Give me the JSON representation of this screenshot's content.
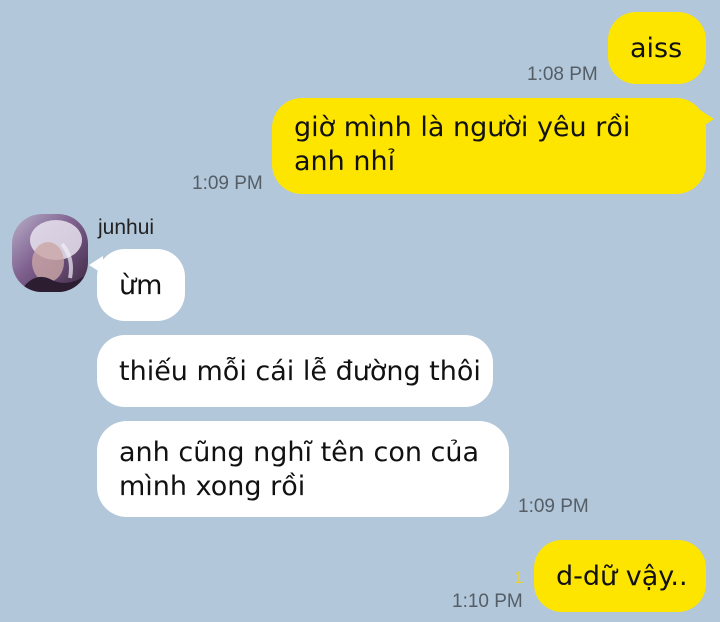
{
  "messages": [
    {
      "side": "out",
      "text": "aiss",
      "time": "1:08 PM"
    },
    {
      "side": "out",
      "text": "giờ mình là người yêu rồi anh nhỉ",
      "time": "1:09 PM"
    },
    {
      "side": "in",
      "sender": "junhui",
      "text": "ừm"
    },
    {
      "side": "in",
      "text": "thiếu mỗi cái lễ đường thôi"
    },
    {
      "side": "in",
      "text": "anh cũng nghĩ tên con của mình xong rồi",
      "time": "1:09 PM"
    },
    {
      "side": "out",
      "text": "d-dữ vậy..",
      "time": "1:10 PM",
      "unread_count": "1"
    }
  ],
  "colors": {
    "background": "#b2c7d9",
    "outgoing_bubble": "#fee500",
    "incoming_bubble": "#ffffff",
    "unread": "#e9d233"
  }
}
